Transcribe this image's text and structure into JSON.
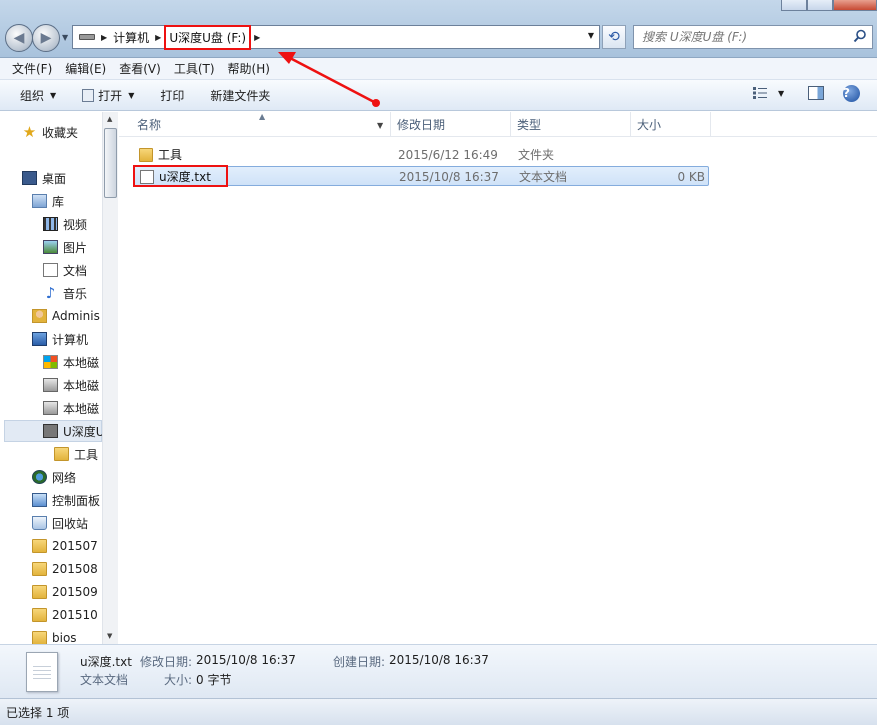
{
  "address": {
    "crumbs": [
      "计算机",
      "U深度U盘 (F:)"
    ]
  },
  "search": {
    "placeholder": "搜索 U深度U盘 (F:)"
  },
  "menubar": [
    "文件(F)",
    "编辑(E)",
    "查看(V)",
    "工具(T)",
    "帮助(H)"
  ],
  "toolbar": {
    "organize": "组织",
    "open": "打开",
    "print": "打印",
    "new_folder": "新建文件夹"
  },
  "nav": {
    "favorites": "收藏夹",
    "desktop": "桌面",
    "libraries": "库",
    "videos": "视频",
    "pictures": "图片",
    "documents": "文档",
    "music": "音乐",
    "admin": "Adminis",
    "computer": "计算机",
    "disk1": "本地磁",
    "disk2": "本地磁",
    "disk3": "本地磁",
    "udisk": "U深度U",
    "tools": "工具",
    "network": "网络",
    "control_panel": "控制面板",
    "recycle_bin": "回收站",
    "f201507": "201507",
    "f201508": "201508",
    "f201509": "201509",
    "f201510": "201510",
    "bios": "bios"
  },
  "columns": {
    "name": "名称",
    "date": "修改日期",
    "type": "类型",
    "size": "大小"
  },
  "files": [
    {
      "name": "工具",
      "date": "2015/6/12 16:49",
      "type": "文件夹",
      "size": ""
    },
    {
      "name": "u深度.txt",
      "date": "2015/10/8 16:37",
      "type": "文本文档",
      "size": "0 KB"
    }
  ],
  "details": {
    "filename": "u深度.txt",
    "modified_label": "修改日期:",
    "modified_value": "2015/10/8 16:37",
    "created_label": "创建日期:",
    "created_value": "2015/10/8 16:37",
    "type": "文本文档",
    "size_label": "大小:",
    "size_value": "0 字节"
  },
  "status": {
    "text": "已选择 1 项"
  },
  "colors": {
    "highlight_red": "#e11111",
    "selection_blue": "#cfe2f8"
  }
}
